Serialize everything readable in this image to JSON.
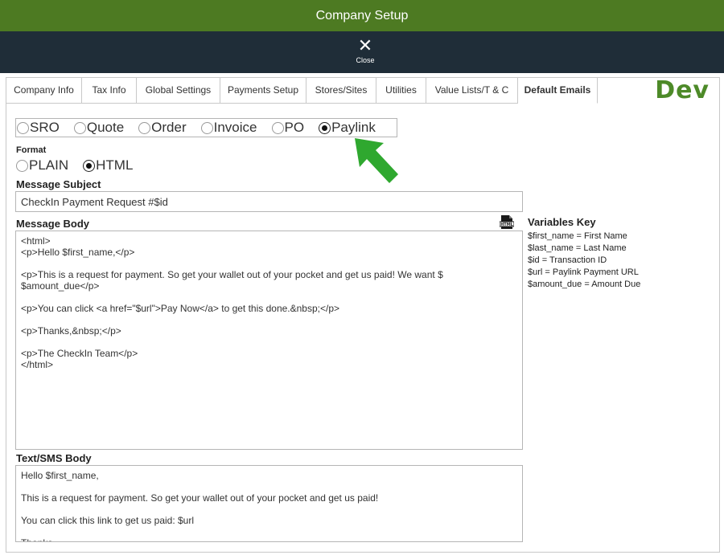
{
  "window": {
    "title": "Company Setup"
  },
  "toolbar": {
    "close_label": "Close"
  },
  "tabs": [
    {
      "label": "Company Info",
      "active": false
    },
    {
      "label": "Tax Info",
      "active": false
    },
    {
      "label": "Global Settings",
      "active": false
    },
    {
      "label": "Payments Setup",
      "active": false
    },
    {
      "label": "Stores/Sites",
      "active": false
    },
    {
      "label": "Utilities",
      "active": false
    },
    {
      "label": "Value Lists/T & C",
      "active": false
    },
    {
      "label": "Default Emails",
      "active": true
    }
  ],
  "badge": "Dev",
  "email_type": {
    "options": [
      "SRO",
      "Quote",
      "Order",
      "Invoice",
      "PO",
      "Paylink"
    ],
    "selected": "Paylink"
  },
  "format": {
    "label": "Format",
    "options": [
      "PLAIN",
      "HTML"
    ],
    "selected": "HTML"
  },
  "message_subject": {
    "label": "Message Subject",
    "value": "CheckIn Payment Request #$id"
  },
  "message_body": {
    "label": "Message Body",
    "lines": [
      "<html>",
      "<p>Hello $first_name,</p>",
      "",
      "<p>This is a request for payment. So get your wallet out of your pocket and get us paid! We want $",
      "$amount_due</p>",
      "",
      "<p>You can click <a href=\"$url\">Pay Now</a> to get this done.&nbsp;</p>",
      "",
      "<p>Thanks,&nbsp;</p>",
      "",
      "<p>The CheckIn Team</p>",
      "</html>"
    ]
  },
  "variables_key": {
    "title": "Variables Key",
    "items": [
      "$first_name = First Name",
      "$last_name = Last Name",
      "$id = Transaction ID",
      "$url = Paylink Payment URL",
      "$amount_due = Amount Due"
    ]
  },
  "sms_body": {
    "label": "Text/SMS Body",
    "lines": [
      "Hello $first_name,",
      "",
      "This is a request for payment. So get your wallet out of your pocket and get us paid!",
      "",
      "You can click this link to get us paid: $url",
      "",
      "Thanks"
    ]
  },
  "icons": {
    "close": "close-icon",
    "html_file": "html-file-icon",
    "arrow": "arrow-pointer-icon"
  },
  "colors": {
    "title_bar": "#4d7a22",
    "toolbar": "#1f2d38",
    "dev_badge": "#4d8a28",
    "arrow": "#2fa82f"
  }
}
